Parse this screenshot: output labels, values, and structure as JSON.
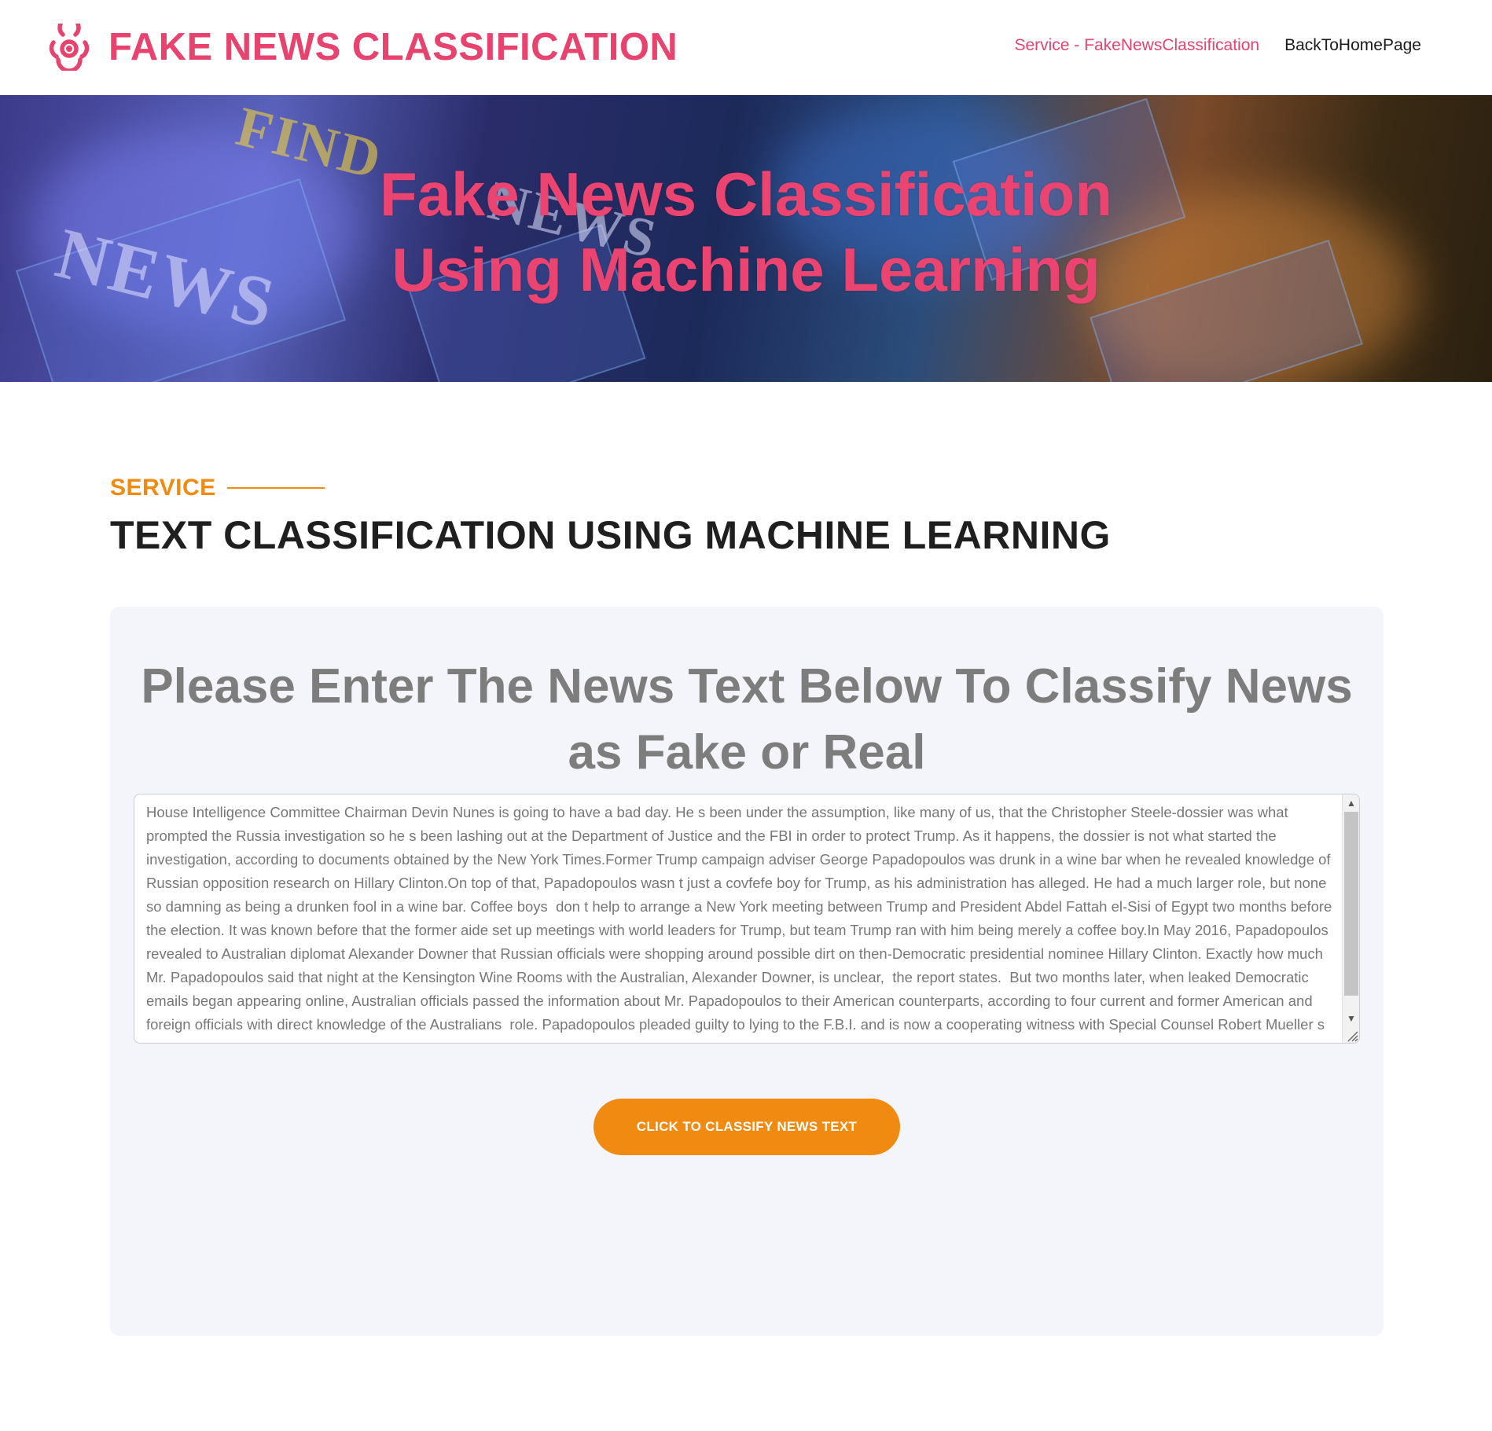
{
  "header": {
    "logo_icon": "biohazard-icon",
    "site_title": "FAKE NEWS CLASSIFICATION",
    "nav": [
      {
        "label": "Service - FakeNewsClassification",
        "active": true
      },
      {
        "label": "BackToHomePage",
        "active": false
      }
    ]
  },
  "hero": {
    "title_line1": "Fake News Classification",
    "title_line2": "Using Machine Learning"
  },
  "section": {
    "eyebrow": "SERVICE",
    "title": "TEXT CLASSIFICATION USING MACHINE LEARNING"
  },
  "card": {
    "title": "Please Enter The News Text Below To Classify News as Fake or Real",
    "textarea_value": "House Intelligence Committee Chairman Devin Nunes is going to have a bad day. He s been under the assumption, like many of us, that the Christopher Steele-dossier was what prompted the Russia investigation so he s been lashing out at the Department of Justice and the FBI in order to protect Trump. As it happens, the dossier is not what started the investigation, according to documents obtained by the New York Times.Former Trump campaign adviser George Papadopoulos was drunk in a wine bar when he revealed knowledge of Russian opposition research on Hillary Clinton.On top of that, Papadopoulos wasn t just a covfefe boy for Trump, as his administration has alleged. He had a much larger role, but none so damning as being a drunken fool in a wine bar. Coffee boys  don t help to arrange a New York meeting between Trump and President Abdel Fattah el-Sisi of Egypt two months before the election. It was known before that the former aide set up meetings with world leaders for Trump, but team Trump ran with him being merely a coffee boy.In May 2016, Papadopoulos revealed to Australian diplomat Alexander Downer that Russian officials were shopping around possible dirt on then-Democratic presidential nominee Hillary Clinton. Exactly how much Mr. Papadopoulos said that night at the Kensington Wine Rooms with the Australian, Alexander Downer, is unclear,  the report states.  But two months later, when leaked Democratic emails began appearing online, Australian officials passed the information about Mr. Papadopoulos to their American counterparts, according to four current and former American and foreign officials with direct knowledge of the Australians  role. Papadopoulos pleaded guilty to lying to the F.B.I. and is now a cooperating witness with Special Counsel Robert Mueller s team.",
    "button_label": "CLICK TO CLASSIFY NEWS TEXT"
  },
  "colors": {
    "brand_pink": "#e8436e",
    "accent_orange": "#f08a10",
    "card_bg": "#f3f5fa"
  }
}
